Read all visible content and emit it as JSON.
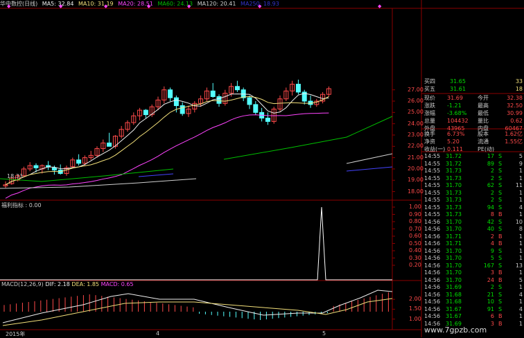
{
  "colors": {
    "up": "#ff4a4a",
    "down": "#54ffff",
    "ma5": "#f0f0f0",
    "ma10": "#f3e07a",
    "ma20": "#ff44ff",
    "ma60": "#00c000",
    "ma120": "#7070ff",
    "grid": "#8b0000",
    "text": "#cccccc"
  },
  "topbar": {
    "title": "华中数控(日线)",
    "ma5": "MA5: 32.84",
    "ma10": "MA10: 31.19",
    "ma20": "MA20: 28.51",
    "ma60": "MA60: 24.13",
    "ma120": "MA120: 20.41",
    "ma250": "MA250: 18.93"
  },
  "main_axis": [
    "27.00",
    "26.00",
    "25.00",
    "24.00",
    "23.00",
    "22.00",
    "21.00",
    "20.00",
    "19.00",
    "18.00"
  ],
  "low_marker": "18.33",
  "indicator": {
    "label": "福利指标 : 0.00",
    "axis": [
      "1.00",
      "0.90",
      "0.80",
      "0.70",
      "0.60",
      "0.50",
      "0.40",
      "0.30",
      "0.20"
    ]
  },
  "macd": {
    "label_name": "MACD(12,26,9)",
    "dif": "DIF: 2.18",
    "dea": "DEA: 1.85",
    "macd": "MACD: 0.65",
    "axis": [
      "2.00",
      "1.50",
      "1.00"
    ]
  },
  "date_axis": {
    "year": "2015年",
    "m4": "4",
    "m5": "5"
  },
  "quotes": [
    {
      "label": "买四",
      "value": "31.65",
      "vol": "33"
    },
    {
      "label": "买五",
      "value": "31.61",
      "vol": "18"
    }
  ],
  "stats": [
    {
      "l1": "现价",
      "v1": "31.69",
      "l2": "今开",
      "v2": "32.38"
    },
    {
      "l1": "涨跌",
      "v1": "-1.21",
      "l2": "最高",
      "v2": "32.50"
    },
    {
      "l1": "涨幅",
      "v1": "-3.68%",
      "l2": "最低",
      "v2": "30.99"
    },
    {
      "l1": "总量",
      "v1": "104432",
      "l2": "量比",
      "v2": "0.62"
    },
    {
      "l1": "外盘",
      "v1": "43965",
      "l2": "内盘",
      "v2": "60467"
    }
  ],
  "stats2": [
    {
      "l1": "换手",
      "v1": "6.73%",
      "l2": "股本",
      "v2": "1.62亿"
    },
    {
      "l1": "净资",
      "v1": "5.20",
      "l2": "流通",
      "v2": "1.55亿"
    },
    {
      "l1": "收益(一)",
      "v1": "0.111",
      "l2": "PE(动)",
      "v2": ""
    }
  ],
  "ticks": [
    {
      "t": "14:55",
      "p": "31.72",
      "v": "17",
      "s": "S",
      "n": "5"
    },
    {
      "t": "14:55",
      "p": "31.72",
      "v": "89",
      "s": "S",
      "n": "9"
    },
    {
      "t": "14:55",
      "p": "31.73",
      "p2": "",
      "v": "2",
      "s": "S",
      "n": "1"
    },
    {
      "t": "14:55",
      "p": "31.73",
      "v": "2",
      "s": "S",
      "n": "1"
    },
    {
      "t": "14:55",
      "p": "31.70",
      "v": "62",
      "s": "S",
      "n": "11"
    },
    {
      "t": "14:55",
      "p": "31.73",
      "v": "2",
      "s": "S",
      "n": "1"
    },
    {
      "t": "14:55",
      "p": "31.73",
      "v": "2",
      "s": "S",
      "n": "1"
    },
    {
      "t": "14:55",
      "p": "31.73",
      "v": "94",
      "s": "S",
      "n": "4"
    },
    {
      "t": "14:55",
      "p": "31.73",
      "v": "8",
      "s": "B",
      "n": "1"
    },
    {
      "t": "14:56",
      "p": "31.70",
      "v": "42",
      "s": "S",
      "n": "10"
    },
    {
      "t": "14:56",
      "p": "31.70",
      "v": "40",
      "s": "S",
      "n": "8"
    },
    {
      "t": "14:56",
      "p": "31.71",
      "v": "2",
      "s": "B",
      "n": "1"
    },
    {
      "t": "14:56",
      "p": "31.71",
      "v": "4",
      "s": "B",
      "n": "1"
    },
    {
      "t": "14:56",
      "p": "31.70",
      "v": "9",
      "s": "S",
      "n": "1"
    },
    {
      "t": "14:56",
      "p": "31.70",
      "v": "5",
      "s": "S",
      "n": "1"
    },
    {
      "t": "14:56",
      "p": "31.70",
      "v": "167",
      "s": "S",
      "n": "13"
    },
    {
      "t": "14:56",
      "p": "31.70",
      "v": "3",
      "s": "B",
      "n": "1"
    },
    {
      "t": "14:56",
      "p": "31.70",
      "v": "24",
      "s": "B",
      "n": "5"
    },
    {
      "t": "14:56",
      "p": "31.69",
      "v": "2",
      "s": "S",
      "n": "1"
    },
    {
      "t": "14:56",
      "p": "31.68",
      "v": "21",
      "s": "S",
      "n": "4"
    },
    {
      "t": "14:56",
      "p": "31.68",
      "v": "10",
      "s": "S",
      "n": "1"
    },
    {
      "t": "14:56",
      "p": "31.67",
      "v": "91",
      "s": "S",
      "n": "4"
    },
    {
      "t": "14:56",
      "p": "31.67",
      "v": "6",
      "s": "B",
      "n": "1"
    },
    {
      "t": "14:56",
      "p": "31.69",
      "v": "3",
      "s": "B",
      "n": "1"
    }
  ],
  "watermark": "www.7gpzb.com",
  "chart_data": {
    "type": "candlestick",
    "candles": [
      [
        18.5,
        18.9,
        18.33,
        18.6
      ],
      [
        18.7,
        19.3,
        18.6,
        19.2
      ],
      [
        19.0,
        19.5,
        18.9,
        19.4
      ],
      [
        19.4,
        20.2,
        19.3,
        20.0
      ],
      [
        20.0,
        20.6,
        19.8,
        20.3
      ],
      [
        20.3,
        20.5,
        19.7,
        20.1
      ],
      [
        20.0,
        20.4,
        19.6,
        20.3
      ],
      [
        20.3,
        20.7,
        19.9,
        20.2
      ],
      [
        20.1,
        20.3,
        19.5,
        19.9
      ],
      [
        19.9,
        20.4,
        19.5,
        19.6
      ],
      [
        19.6,
        20.3,
        19.4,
        20.1
      ],
      [
        20.2,
        21.0,
        20.1,
        20.8
      ],
      [
        20.8,
        21.3,
        20.3,
        20.5
      ],
      [
        20.5,
        21.2,
        20.3,
        21.0
      ],
      [
        21.0,
        21.6,
        20.8,
        21.2
      ],
      [
        21.2,
        22.0,
        21.0,
        21.8
      ],
      [
        21.8,
        22.6,
        21.5,
        22.3
      ],
      [
        22.3,
        23.2,
        22.0,
        22.0
      ],
      [
        22.0,
        23.0,
        21.8,
        22.9
      ],
      [
        22.9,
        23.8,
        22.7,
        23.5
      ],
      [
        23.5,
        24.3,
        23.3,
        24.1
      ],
      [
        24.1,
        25.0,
        23.9,
        24.7
      ],
      [
        24.7,
        25.4,
        24.3,
        25.2
      ],
      [
        25.2,
        25.3,
        24.5,
        24.8
      ],
      [
        24.8,
        25.7,
        24.6,
        25.5
      ],
      [
        25.5,
        26.4,
        25.2,
        26.1
      ],
      [
        26.1,
        27.3,
        25.8,
        27.0
      ],
      [
        27.0,
        27.2,
        26.0,
        26.3
      ],
      [
        26.3,
        26.5,
        25.0,
        25.6
      ],
      [
        25.6,
        25.9,
        24.7,
        24.9
      ],
      [
        24.9,
        25.6,
        24.6,
        25.3
      ],
      [
        25.3,
        26.0,
        25.0,
        25.8
      ],
      [
        25.8,
        26.5,
        25.5,
        26.2
      ],
      [
        26.2,
        27.2,
        26.0,
        26.9
      ],
      [
        26.9,
        27.6,
        26.3,
        26.4
      ],
      [
        26.4,
        26.6,
        25.5,
        25.8
      ],
      [
        25.8,
        27.0,
        25.6,
        26.7
      ],
      [
        26.7,
        27.6,
        26.4,
        27.3
      ],
      [
        27.3,
        27.8,
        26.8,
        27.0
      ],
      [
        27.0,
        27.2,
        26.0,
        26.3
      ],
      [
        26.3,
        26.5,
        25.3,
        25.7
      ],
      [
        25.7,
        26.0,
        24.8,
        25.0
      ],
      [
        25.0,
        25.4,
        24.2,
        24.5
      ],
      [
        24.5,
        25.0,
        23.9,
        24.2
      ],
      [
        24.2,
        25.5,
        24.0,
        25.3
      ],
      [
        25.3,
        26.5,
        25.1,
        26.2
      ],
      [
        26.2,
        27.2,
        26.0,
        26.9
      ],
      [
        26.9,
        27.8,
        26.5,
        27.5
      ],
      [
        27.5,
        27.9,
        26.6,
        26.8
      ],
      [
        26.8,
        27.0,
        25.7,
        26.0
      ],
      [
        26.0,
        26.5,
        25.4,
        25.7
      ],
      [
        25.7,
        26.2,
        25.5,
        26.0
      ],
      [
        26.0,
        26.8,
        25.8,
        26.6
      ],
      [
        26.6,
        27.3,
        26.4,
        27.1
      ]
    ],
    "price_range": [
      17.3,
      27.9
    ],
    "indicator_spike": {
      "index": 45,
      "value": 1.0
    },
    "macd_range": [
      0.5,
      2.6
    ],
    "title": "华中数控(日线)"
  }
}
